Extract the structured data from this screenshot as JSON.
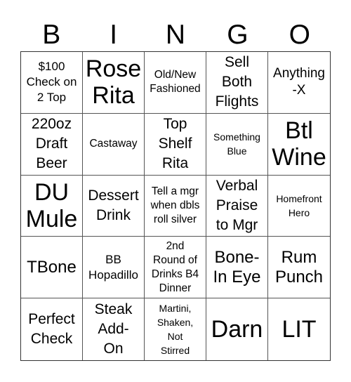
{
  "header": {
    "letters": [
      "B",
      "I",
      "N",
      "G",
      "O"
    ]
  },
  "cells": [
    {
      "text": "$100\nCheck on\n2 Top",
      "size": "s-s"
    },
    {
      "text": "Rose\nRita",
      "size": "s-xl"
    },
    {
      "text": "Old/New\nFashioned",
      "size": "s-xs"
    },
    {
      "text": "Sell\nBoth\nFlights",
      "size": "s-m"
    },
    {
      "text": "Anything\n-X",
      "size": "s-ms"
    },
    {
      "text": "220oz\nDraft\nBeer",
      "size": "s-m"
    },
    {
      "text": "Castaway",
      "size": "s-xs"
    },
    {
      "text": "Top\nShelf\nRita",
      "size": "s-m"
    },
    {
      "text": "Something\nBlue",
      "size": "s-xxs"
    },
    {
      "text": "Btl\nWine",
      "size": "s-xl"
    },
    {
      "text": "DU\nMule",
      "size": "s-xl"
    },
    {
      "text": "Dessert\nDrink",
      "size": "s-m"
    },
    {
      "text": "Tell a mgr\nwhen dbls\nroll silver",
      "size": "s-xs"
    },
    {
      "text": "Verbal\nPraise\nto Mgr",
      "size": "s-m"
    },
    {
      "text": "Homefront\nHero",
      "size": "s-xxs"
    },
    {
      "text": "TBone",
      "size": "s-l"
    },
    {
      "text": "BB\nHopadillo",
      "size": "s-s"
    },
    {
      "text": "2nd\nRound of\nDrinks B4\nDinner",
      "size": "s-xs"
    },
    {
      "text": "Bone-\nIn Eye",
      "size": "s-l"
    },
    {
      "text": "Rum\nPunch",
      "size": "s-l"
    },
    {
      "text": "Perfect\nCheck",
      "size": "s-m"
    },
    {
      "text": "Steak\nAdd-\nOn",
      "size": "s-m"
    },
    {
      "text": "Martini,\nShaken,\nNot\nStirred",
      "size": "s-xxs"
    },
    {
      "text": "Darn",
      "size": "s-xl"
    },
    {
      "text": "LIT",
      "size": "s-xl"
    }
  ]
}
